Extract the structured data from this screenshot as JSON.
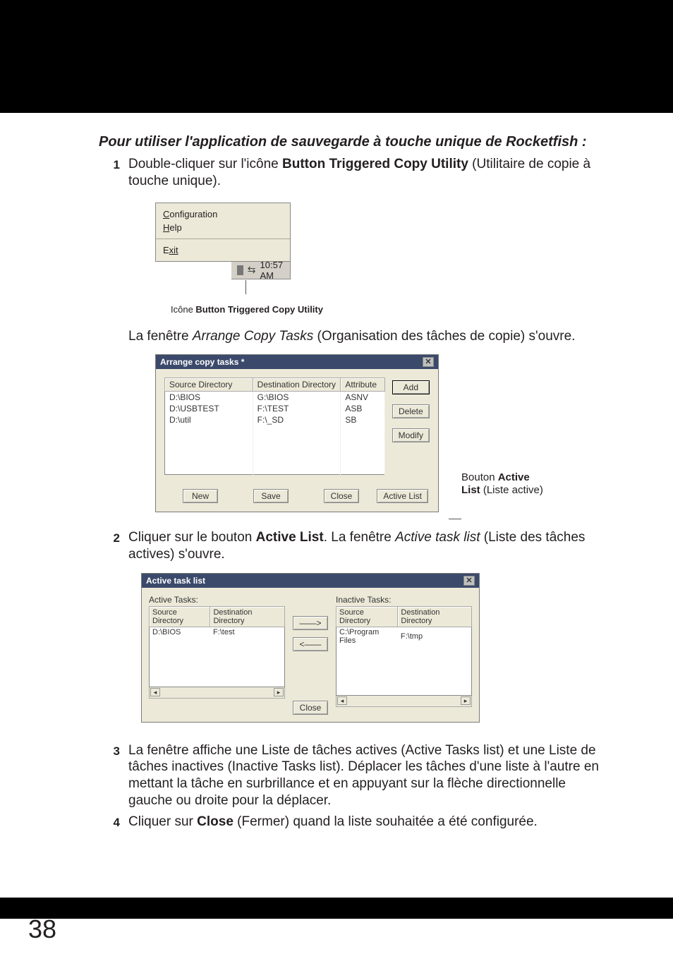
{
  "section_title": "Pour utiliser l'application de sauvegarde à touche unique de Rocketfish :",
  "steps": {
    "s1": {
      "num": "1",
      "pre": "Double-cliquer sur l'icône ",
      "bold": "Button Triggered Copy Utility",
      "post": " (Utilitaire de copie à touche unique)."
    },
    "s2": {
      "num": "2",
      "pre": "Cliquer sur le bouton ",
      "bold": "Active List",
      "mid": ". La fenêtre ",
      "italic": "Active task list",
      "post": " (Liste des tâches actives) s'ouvre."
    },
    "s3": {
      "num": "3",
      "text": "La fenêtre affiche une Liste de tâches actives (Active Tasks list) et une Liste de tâches inactives (Inactive Tasks list). Déplacer les tâches d'une liste à l'autre en mettant la tâche en surbrillance et en appuyant sur la flèche directionnelle gauche ou droite pour la déplacer."
    },
    "s4": {
      "num": "4",
      "pre": "Cliquer sur ",
      "bold": "Close",
      "post": " (Fermer) quand la liste souhaitée a été configurée."
    }
  },
  "fig1": {
    "menu": {
      "configuration": "Configuration",
      "help": "Help",
      "exit_label": "E",
      "exit_rest": "xit"
    },
    "tray_time": "10:57 AM",
    "caption_pre": "Icône ",
    "caption_bold": "Button Triggered Copy Utility"
  },
  "after_fig1": {
    "pre": "La fenêtre ",
    "italic": "Arrange Copy Tasks",
    "post": " (Organisation des tâches de copie) s'ouvre."
  },
  "fig2": {
    "title": "Arrange copy tasks *",
    "headers": {
      "src": "Source Directory",
      "dst": "Destination Directory",
      "attr": "Attribute"
    },
    "rows": [
      {
        "src": "D:\\BIOS",
        "dst": "G:\\BIOS",
        "attr": "ASNV"
      },
      {
        "src": "D:\\USBTEST",
        "dst": "F:\\TEST",
        "attr": "ASB"
      },
      {
        "src": "D:\\util",
        "dst": "F:\\_SD",
        "attr": "SB"
      }
    ],
    "btns": {
      "add": "Add",
      "delete": "Delete",
      "modify": "Modify",
      "new": "New",
      "save": "Save",
      "close": "Close",
      "active": "Active List"
    }
  },
  "callout": {
    "l1_pre": "Bouton ",
    "l1_bold": "Active",
    "l2_bold": "List",
    "l2_post": " (Liste active)"
  },
  "fig3": {
    "title": "Active task list",
    "active_label": "Active Tasks:",
    "inactive_label": "Inactive Tasks:",
    "hdr_src": "Source Directory",
    "hdr_dst": "Destination Directory",
    "active_row": {
      "src": "D:\\BIOS",
      "dst": "F:\\test"
    },
    "inactive_row": {
      "src": "C:\\Program Files",
      "dst": "F:\\tmp"
    },
    "close": "Close"
  },
  "page_number": "38"
}
